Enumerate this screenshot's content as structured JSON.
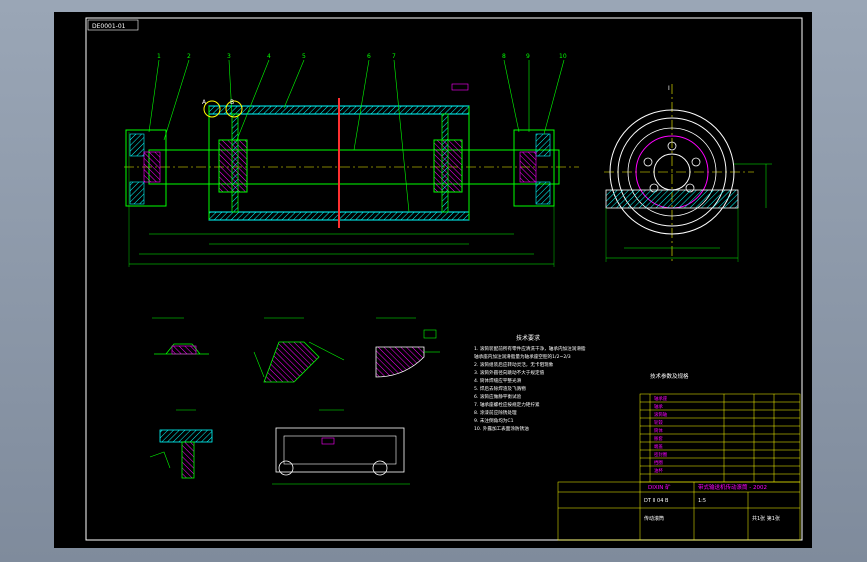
{
  "title_tag": "DE0001-01",
  "section_labels": {
    "a": "A",
    "b": "B",
    "view_a": "A向",
    "view_b": "B-B",
    "i": "I"
  },
  "callouts": [
    "1",
    "2",
    "3",
    "4",
    "5",
    "6",
    "7",
    "8",
    "9",
    "10"
  ],
  "tech_requirements": {
    "heading": "技术要求",
    "lines": [
      "1. 滚筒装配前所有零件应清洗干净，轴承内加注润滑脂",
      "   轴承座内加注润滑脂量为轴承座空腔的1/2~2/3",
      "2. 滚筒组装后应转动灵活，无卡阻现象",
      "3. 滚筒外圆径向跳动不大于规定值",
      "4. 筒体焊缝应平整光滑",
      "5. 焊后去除焊渣及飞溅物",
      "6. 滚筒应做静平衡试验",
      "7. 轴承座螺栓应按规定力矩拧紧",
      "8. 涂漆前应除锈处理",
      "9. 未注倒角均为C1",
      "10. 外露加工表面涂防锈油"
    ]
  },
  "table_heading": "技术参数及规格",
  "title_block": {
    "school": "DIXIN 矿",
    "drawing_name": "带式输送机传动滚筒 - 2002",
    "code": "DT II 04 B",
    "scale": "1:5",
    "sheet": "共1张 第1张",
    "part": "传动滚筒"
  },
  "parts_rows": [
    "轴承座",
    "轴承",
    "滚筒轴",
    "轮毂",
    "筒体",
    "胀套",
    "端盖",
    "密封圈",
    "挡圈",
    "油杯"
  ],
  "colors": {
    "outline": "#00ff00",
    "hatch": "#00ffff",
    "centerline": "#ffff00",
    "accent": "#ff00ff",
    "cut": "#ff3030",
    "white": "#ffffff"
  }
}
